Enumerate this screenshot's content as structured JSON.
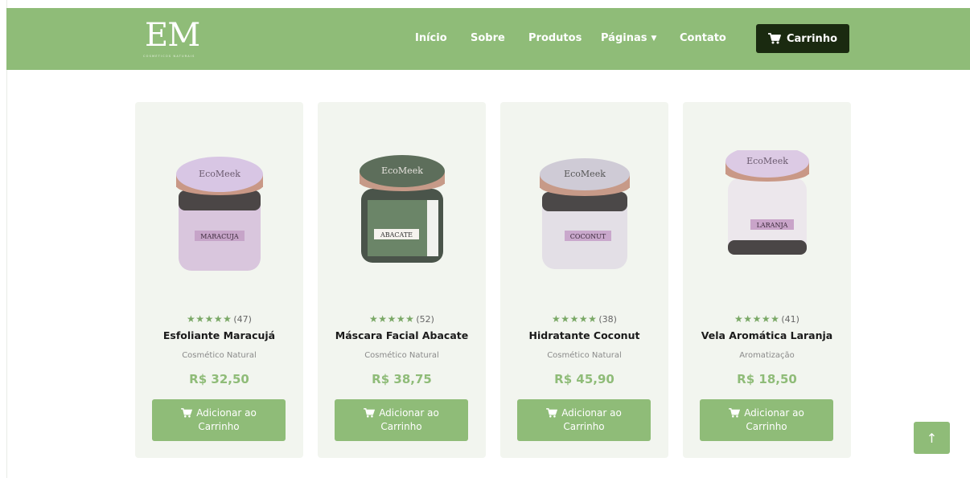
{
  "brand": {
    "logo_text": "EM",
    "tagline": "COSMÉTICOS NATURAIS"
  },
  "nav": {
    "items": [
      {
        "label": "Início"
      },
      {
        "label": "Sobre"
      },
      {
        "label": "Produtos"
      },
      {
        "label": "Páginas",
        "dropdown": true
      },
      {
        "label": "Contato"
      }
    ],
    "cart_label": "Carrinho",
    "cart_icon": "cart-icon"
  },
  "products": [
    {
      "name": "Esfoliante Maracujá",
      "category": "Cosmético Natural",
      "price": "R$ 32,50",
      "stars": "★★★★★",
      "rating_count": "(47)",
      "rating": 5,
      "jar_label": "MARACUJA",
      "jar_lid_text": "EcoMeek",
      "jar_color": "#d9c6dd",
      "button_line1": "Adicionar ao",
      "button_line2": "Carrinho"
    },
    {
      "name": "Máscara Facial Abacate",
      "category": "Cosmético Natural",
      "price": "R$ 38,75",
      "stars": "★★★★★",
      "rating_count": "(52)",
      "rating": 5,
      "jar_label": "ABACATE",
      "jar_lid_text": "EcoMeek",
      "jar_color": "#6b8568",
      "button_line1": "Adicionar ao",
      "button_line2": "Carrinho"
    },
    {
      "name": "Hidratante Coconut",
      "category": "Cosmético Natural",
      "price": "R$ 45,90",
      "stars": "★★★★★",
      "rating_count": "(38)",
      "rating": 5,
      "jar_label": "COCONUT",
      "jar_lid_text": "EcoMeek",
      "jar_color": "#e3dfe6",
      "button_line1": "Adicionar ao",
      "button_line2": "Carrinho"
    },
    {
      "name": "Vela Aromática Laranja",
      "category": "Aromatização",
      "price": "R$ 18,50",
      "stars": "★★★★★",
      "rating_count": "(41)",
      "rating": 5,
      "jar_label": "LARANJA",
      "jar_lid_text": "EcoMeek",
      "jar_color": "#ece7ec",
      "button_line1": "Adicionar ao",
      "button_line2": "Carrinho"
    }
  ],
  "scroll_top_label": "↑",
  "colors": {
    "brand_green": "#8fbc78",
    "dark_button": "#1a2a10",
    "card_bg": "#f2f5ef",
    "star": "#7aa866"
  }
}
